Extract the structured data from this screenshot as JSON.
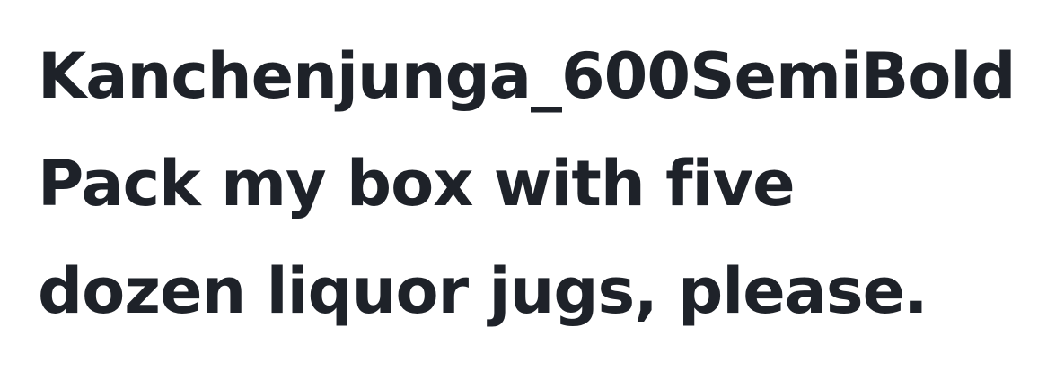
{
  "font_name": "Kanchenjunga_600SemiBold",
  "sample_text": {
    "line1": "Pack my box with five",
    "line2": "dozen liquor jugs, please."
  },
  "colors": {
    "text": "#1e2229",
    "background": "#ffffff"
  }
}
